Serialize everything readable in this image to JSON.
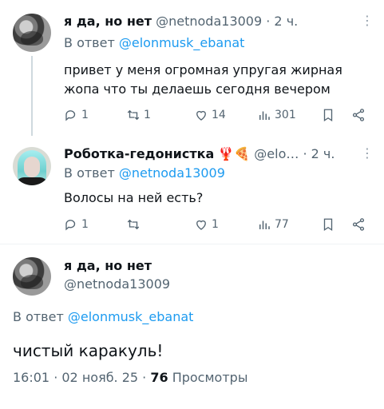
{
  "tweets": [
    {
      "name": "я да, но нет",
      "handle": "@netnoda13009",
      "time": "· 2 ч.",
      "reply_prefix": "В ответ",
      "reply_to": "@elonmusk_ebanat",
      "text_line1": "привет у меня огромная упругая жирная",
      "text_line2": "жопа что ты делаешь сегодня вечером",
      "replies": "1",
      "reposts": "1",
      "likes": "14",
      "views": "301"
    },
    {
      "name": "Роботка-гедонистка",
      "emoji": "🦞🍕",
      "handle": "@elo…",
      "time": "· 2 ч.",
      "reply_prefix": "В ответ",
      "reply_to": "@netnoda13009",
      "text": "Волосы на ней есть?",
      "replies": "1",
      "reposts": "",
      "likes": "1",
      "views": "77"
    }
  ],
  "main_tweet": {
    "name": "я да, но нет",
    "handle": "@netnoda13009",
    "reply_prefix": "В ответ",
    "reply_to": "@elonmusk_ebanat",
    "text": "чистый каракуль!",
    "timestamp": "16:01 · 02 нояб. 25 · ",
    "views_count": "76",
    "views_label": "Просмотры"
  },
  "more_symbol": "⋮",
  "colors": {
    "accent": "#1d9bf0",
    "muted": "#536471",
    "text": "#0f1419"
  }
}
